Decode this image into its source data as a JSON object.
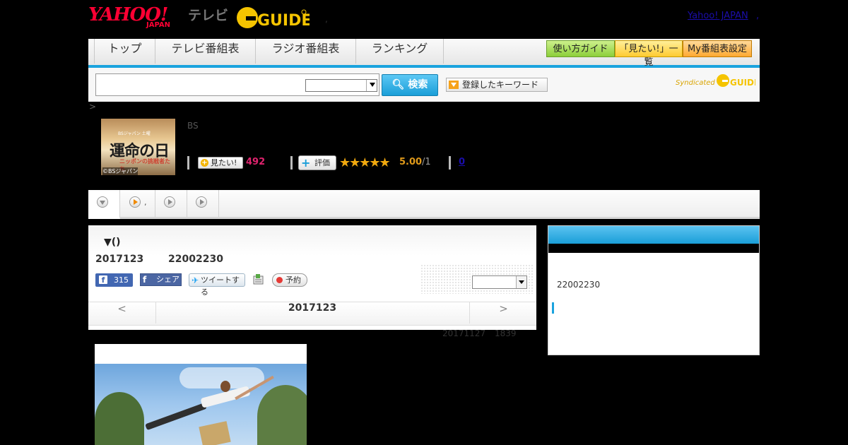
{
  "header": {
    "yahoo_logo_main": "YAHOO!",
    "yahoo_logo_sub": "JAPAN",
    "tv_label": "テレビ",
    "gguide_logo": "G-GUIDE",
    "yahoo_japan_link": "Yahoo! JAPAN",
    "link_suffix": ","
  },
  "nav": {
    "tabs": [
      "トップ",
      "テレビ番組表",
      "ラジオ番組表",
      "ランキング"
    ],
    "buttons": [
      "使い方ガイド",
      "「見たい!」一覧",
      "My番組表設定"
    ],
    "button_colors": [
      "#9ed84a",
      "#ffd24a",
      "#ffb84a"
    ]
  },
  "search": {
    "placeholder": "",
    "button_label": "検索",
    "keyword_label": "登録したキーワード",
    "syndicated": "Syndicated"
  },
  "breadcrumb": ">",
  "program": {
    "thumb_title": "運命の日",
    "thumb_sub": "ニッポンの挑戦者たち",
    "thumb_top": "BSジャパン 土曜",
    "thumb_credit": "©BSジャパン",
    "channel": "BS",
    "want_label": "見たい!",
    "want_count": "492",
    "rate_label": "評価",
    "stars": "★★★★★",
    "rating_value": "5.00",
    "rating_count": "/1",
    "comment_count": "0"
  },
  "tabs": {
    "tab2_label": ","
  },
  "detail": {
    "section_title": "▼()",
    "air_date": "2017123",
    "air_time": "22002230",
    "fb_like_count": "315",
    "fb_share": "シェア",
    "tweet": "ツイートする",
    "reserve": "予約",
    "prev": "<",
    "nav_date": "2017123",
    "next": ">",
    "update_date": "20171127",
    "update_time": "1839"
  },
  "sidebar": {
    "time": "22002230"
  },
  "colors": {
    "accent_blue": "#1aa3de",
    "want_pink": "#e0236e",
    "star_orange": "#f0a80e"
  }
}
